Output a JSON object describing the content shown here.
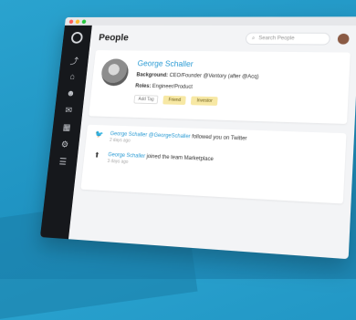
{
  "window": {
    "title": "People",
    "colors": {
      "close": "#ff5f57",
      "minimize": "#febc2e",
      "maximize": "#28c840",
      "accent": "#2a9bd4"
    }
  },
  "sidebar": {
    "icons": [
      "logo-icon",
      "chart-icon",
      "home-icon",
      "people-icon",
      "message-icon",
      "calendar-icon",
      "settings-icon",
      "docs-icon"
    ]
  },
  "search": {
    "placeholder": "Search People"
  },
  "profile": {
    "name": "George Schaller",
    "background_label": "Background:",
    "background_text": "CEO/Founder @Ventory (after @Acq)",
    "roles_label": "Roles:",
    "roles_text": "Engineer/Product",
    "tag_muted": "Add Tag",
    "tags": [
      "Friend",
      "Investor"
    ]
  },
  "feed": {
    "items": [
      {
        "icon": "twitter-icon",
        "name": "George Schaller @GeorgeSchaller",
        "action": "followed you on Twitter",
        "time": "2 days ago"
      },
      {
        "icon": "upload-icon",
        "name": "George Schaller",
        "action": "joined the team Marketplace",
        "time": "3 days ago"
      }
    ]
  }
}
